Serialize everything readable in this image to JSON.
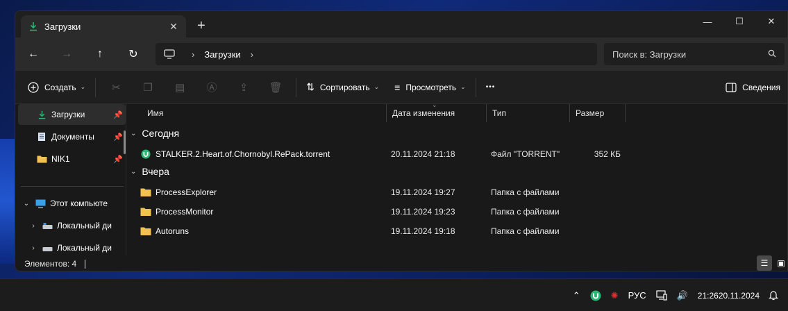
{
  "window": {
    "tab_title": "Загрузки",
    "new_tab_symbol": "+",
    "controls": {
      "minimize": "—",
      "maximize": "☐",
      "close": "✕"
    }
  },
  "navbar": {
    "back": "←",
    "forward": "→",
    "up": "↑",
    "refresh": "↻",
    "breadcrumb": [
      "Загрузки"
    ],
    "search_placeholder": "Поиск в: Загрузки"
  },
  "toolbar": {
    "create_label": "Создать",
    "sort_label": "Сортировать",
    "view_label": "Просмотреть",
    "more_label": "•••",
    "details_label": "Сведения"
  },
  "sidebar": {
    "quick_access": [
      {
        "label": "Загрузки",
        "icon": "download-icon",
        "pinned": true,
        "active": true
      },
      {
        "label": "Документы",
        "icon": "document-icon",
        "pinned": true,
        "active": false
      },
      {
        "label": "NIK1",
        "icon": "folder-icon",
        "pinned": true,
        "active": false
      }
    ],
    "tree": [
      {
        "label": "Этот компьюте",
        "icon": "computer-icon",
        "expanded": true
      },
      {
        "label": "Локальный ди",
        "icon": "drive-icon",
        "expanded": false
      },
      {
        "label": "Локальный ди",
        "icon": "drive-icon",
        "expanded": false
      }
    ]
  },
  "columns": {
    "name": "Имя",
    "date": "Дата изменения",
    "type": "Тип",
    "size": "Размер"
  },
  "groups": [
    {
      "label": "Сегодня",
      "items": [
        {
          "name": "STALKER.2.Heart.of.Chornobyl.RePack.torrent",
          "date": "20.11.2024 21:18",
          "type": "Файл \"TORRENT\"",
          "size": "352 КБ",
          "icon": "utorrent-icon"
        }
      ]
    },
    {
      "label": "Вчера",
      "items": [
        {
          "name": "ProcessExplorer",
          "date": "19.11.2024 19:27",
          "type": "Папка с файлами",
          "size": "",
          "icon": "folder-icon"
        },
        {
          "name": "ProcessMonitor",
          "date": "19.11.2024 19:23",
          "type": "Папка с файлами",
          "size": "",
          "icon": "folder-icon"
        },
        {
          "name": "Autoruns",
          "date": "19.11.2024 19:18",
          "type": "Папка с файлами",
          "size": "",
          "icon": "folder-icon"
        }
      ]
    }
  ],
  "status": {
    "items_count": "Элементов: 4"
  },
  "taskbar": {
    "language": "РУС",
    "time": "21:26",
    "date": "20.11.2024"
  },
  "colors": {
    "accent": "#2bb673",
    "folder": "#f2c14e",
    "window_bg": "#191919"
  }
}
